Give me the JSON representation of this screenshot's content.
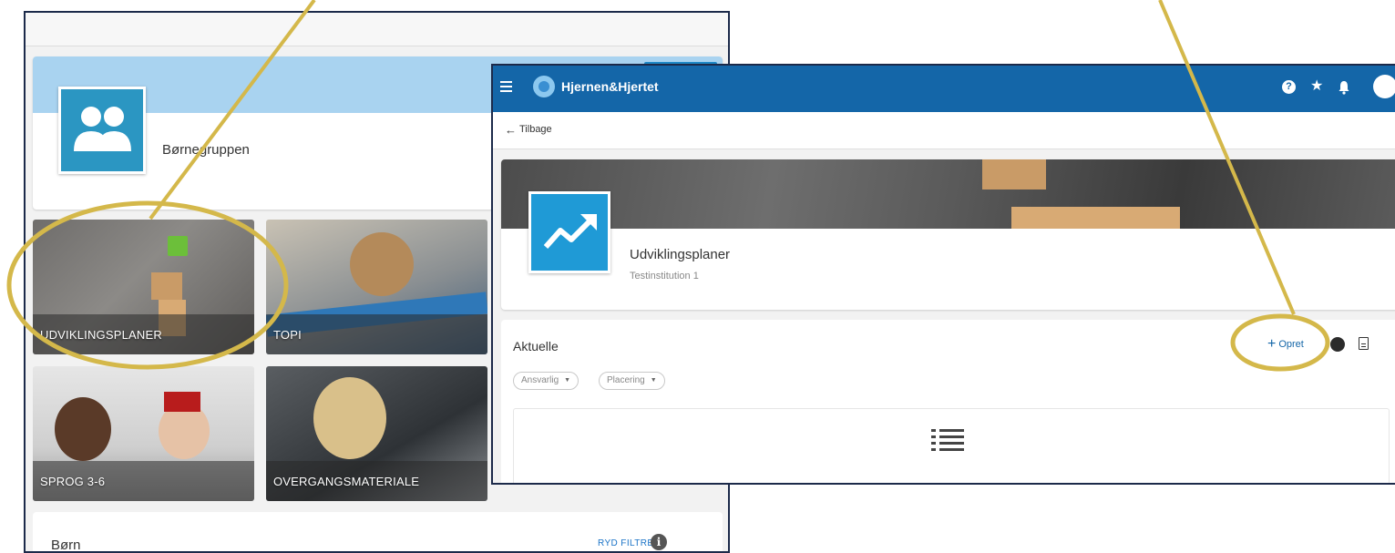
{
  "left_screen": {
    "group": {
      "name": "Børnegruppen"
    },
    "tiles": [
      {
        "label": "UDVIKLINGSPLANER"
      },
      {
        "label": "TOPI"
      },
      {
        "label": "SPROG 3-6"
      },
      {
        "label": "OVERGANGSMATERIALE"
      }
    ],
    "children_section": {
      "title": "Børn",
      "clear_filters": "RYD FILTRE",
      "info_glyph": "i"
    }
  },
  "right_screen": {
    "app_bar": {
      "brand": "Hjernen&Hjertet",
      "icons": [
        "menu-icon",
        "help-icon",
        "star-icon",
        "bell-icon",
        "account-icon"
      ],
      "help_glyph": "?",
      "star_glyph": "★"
    },
    "back": {
      "arrow": "←",
      "label": "Tilbage"
    },
    "plan": {
      "title": "Udviklingsplaner",
      "subtitle": "Testinstitution 1"
    },
    "current": {
      "title": "Aktuelle",
      "create_plus": "+",
      "create_label": "Opret",
      "filters": [
        {
          "label": "Ansvarlig",
          "caret": "▼"
        },
        {
          "label": "Placering",
          "caret": "▼"
        }
      ]
    }
  },
  "colors": {
    "app_bar": "#1466a8",
    "annotation": "#d4b84a",
    "group_banner": "#a9d3f0",
    "plan_avatar": "#1f9ad6"
  }
}
